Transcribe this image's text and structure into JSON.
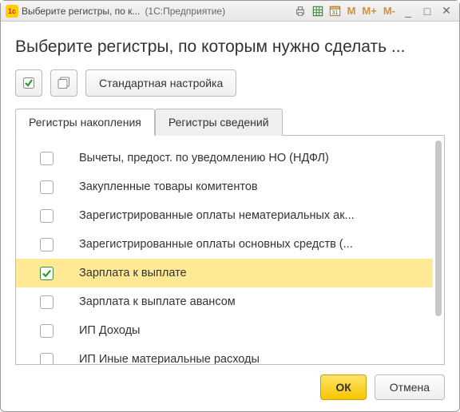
{
  "titlebar": {
    "short_title": "Выберите регистры, по к...",
    "app_name": "(1С:Предприятие)"
  },
  "heading": "Выберите регистры, по которым нужно сделать ...",
  "toolbar": {
    "std_label": "Стандартная настройка"
  },
  "tabs": [
    {
      "label": "Регистры накопления",
      "active": true
    },
    {
      "label": "Регистры сведений",
      "active": false
    }
  ],
  "rows": [
    {
      "label": "Вычеты, предост. по уведомлению НО (НДФЛ)",
      "checked": false,
      "selected": false
    },
    {
      "label": "Закупленные товары комитентов",
      "checked": false,
      "selected": false
    },
    {
      "label": "Зарегистрированные оплаты нематериальных ак...",
      "checked": false,
      "selected": false
    },
    {
      "label": "Зарегистрированные оплаты основных средств (...",
      "checked": false,
      "selected": false
    },
    {
      "label": "Зарплата к выплате",
      "checked": true,
      "selected": true
    },
    {
      "label": "Зарплата к выплате авансом",
      "checked": false,
      "selected": false
    },
    {
      "label": "ИП Доходы",
      "checked": false,
      "selected": false
    },
    {
      "label": "ИП Иные материальные расходы",
      "checked": false,
      "selected": false
    }
  ],
  "footer": {
    "ok": "ОК",
    "cancel": "Отмена"
  }
}
